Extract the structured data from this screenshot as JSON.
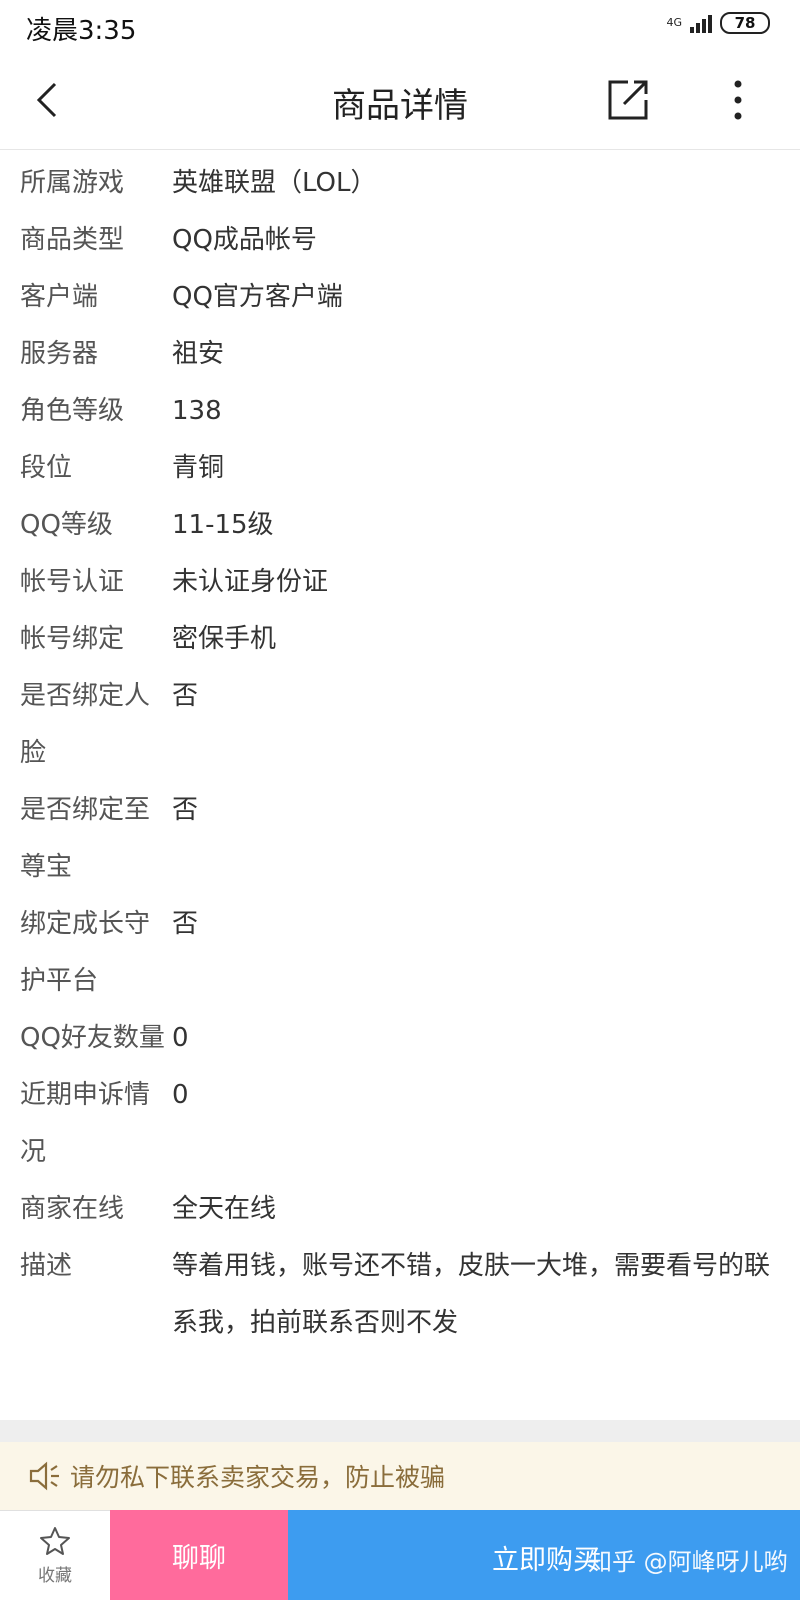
{
  "status_bar": {
    "time": "凌晨3:35",
    "network": "4G",
    "battery": "78"
  },
  "header": {
    "title": "商品详情"
  },
  "details": [
    {
      "label": "所属游戏",
      "value": "英雄联盟（LOL）"
    },
    {
      "label": "商品类型",
      "value": "QQ成品帐号"
    },
    {
      "label": "客户端",
      "value": "QQ官方客户端"
    },
    {
      "label": "服务器",
      "value": "祖安"
    },
    {
      "label": "角色等级",
      "value": "138"
    },
    {
      "label": "段位",
      "value": "青铜"
    },
    {
      "label": "QQ等级",
      "value": "11-15级"
    },
    {
      "label": "帐号认证",
      "value": "未认证身份证"
    },
    {
      "label": "帐号绑定",
      "value": "密保手机"
    },
    {
      "label": "是否绑定人脸",
      "value": "否"
    },
    {
      "label": "是否绑定至尊宝",
      "value": "否"
    },
    {
      "label": "绑定成长守护平台",
      "value": "否"
    },
    {
      "label": "QQ好友数量",
      "value": "0"
    },
    {
      "label": "近期申诉情况",
      "value": "0"
    },
    {
      "label": "商家在线",
      "value": "全天在线"
    },
    {
      "label": "描述",
      "value": "等着用钱，账号还不错，皮肤一大堆，需要看号的联系我，拍前联系否则不发"
    }
  ],
  "notice": {
    "text": "请勿私下联系卖家交易，防止被骗"
  },
  "bottom_bar": {
    "favorite_label": "收藏",
    "chat_label": "聊聊",
    "buy_label": "立即购买",
    "watermark": "知乎 @阿峰呀儿哟"
  }
}
